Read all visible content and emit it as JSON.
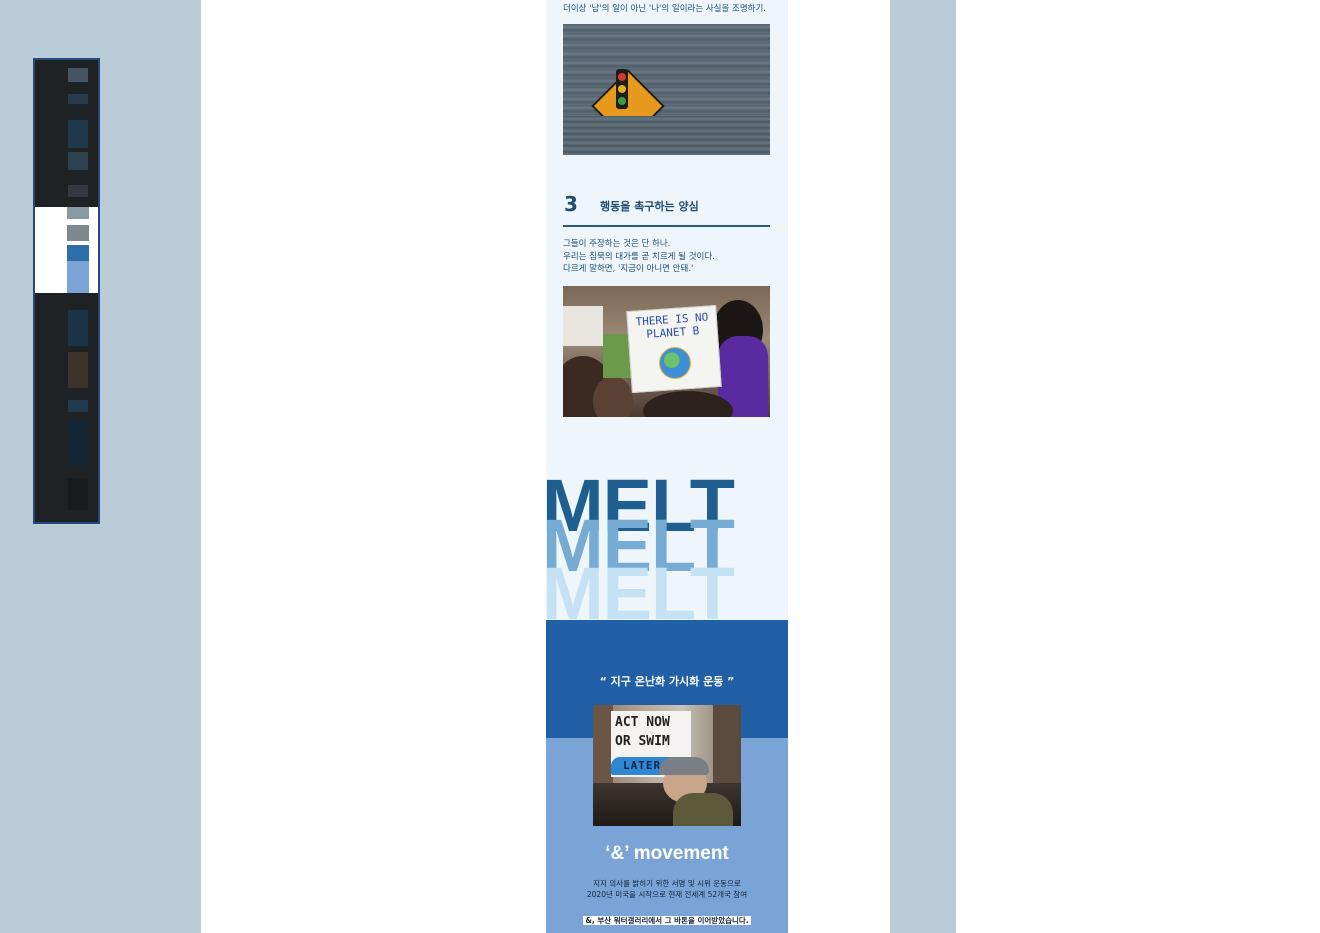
{
  "layout_colors": {
    "side_panel": "#b9ccd8",
    "document_bg": "#eef6fc",
    "primary_blue": "#1f4c72",
    "band_dark_blue": "#215fa6",
    "band_light_blue": "#7aa4d6"
  },
  "navigator": {
    "icon": "page-thumbnail-navigator"
  },
  "document": {
    "intro_caption": "더이상 '남'의 일이 아닌 '나'의 일이라는 사실을 조명하기.",
    "photo_1_icon": "traffic-light-sign-in-flood-photo",
    "section": {
      "number": "3",
      "title": "행동을 촉구하는 양심",
      "lines": [
        "그들이 주장하는 것은 단 하나.",
        "우리는 침묵의 대가를 곧 치르게 될 것이다.",
        "다르게 말하면, '지금이 아니면 안돼.'"
      ]
    },
    "photo_2": {
      "icon": "climate-protest-photo",
      "sign_text_line1": "THERE IS NO",
      "sign_text_line2": "PLANET B"
    },
    "melt_lines": [
      "MELT",
      "MELT",
      "MELT"
    ],
    "quote": "“ 지구 온난화 가시화 운동 ”",
    "photo_3": {
      "icon": "act-now-protest-photo",
      "sign_line1": "ACT NOW",
      "sign_line2": "OR SWIM",
      "sign_line3": "LATER"
    },
    "movement_title": "‘&’ movement",
    "movement_desc": [
      "지지 의사를 밝히기 위한 서명 및 시위 운동으로",
      "2020년 미국을 시작으로 현재 전세계 52개국 참여"
    ],
    "movement_note": "&, 부산 워터갤러리에서 그 바톤을 이어받았습니다."
  }
}
